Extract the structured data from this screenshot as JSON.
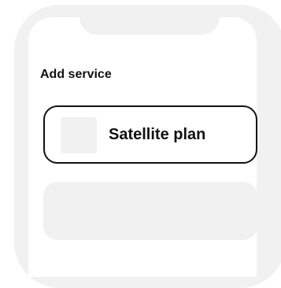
{
  "screen": {
    "title": "Add service"
  },
  "services": [
    {
      "label": "Satellite plan",
      "icon": "service-placeholder-icon"
    }
  ],
  "colors": {
    "frame": "#f1f1f1",
    "text": "#111111",
    "border": "#111111",
    "background": "#ffffff"
  }
}
